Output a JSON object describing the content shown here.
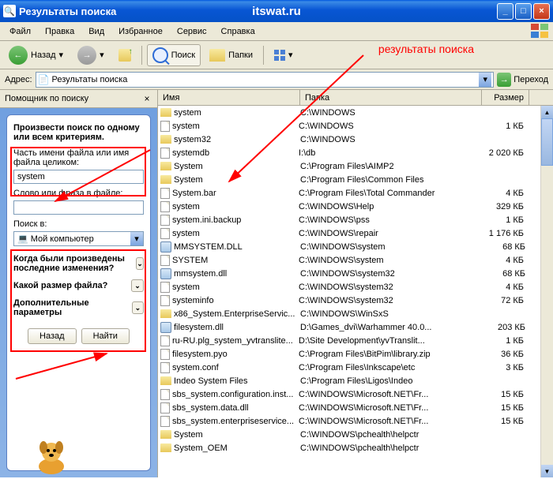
{
  "window": {
    "title": "Результаты поиска",
    "center_text": "itswat.ru"
  },
  "menu": {
    "file": "Файл",
    "edit": "Правка",
    "view": "Вид",
    "favorites": "Избранное",
    "tools": "Сервис",
    "help": "Справка"
  },
  "toolbar": {
    "back": "Назад",
    "search": "Поиск",
    "folders": "Папки",
    "annotation": "результаты поиска"
  },
  "address": {
    "label": "Адрес:",
    "value": "Результаты поиска",
    "go": "Переход"
  },
  "sidebar": {
    "header": "Помощник по поиску",
    "criteria": "Произвести поиск по одному или всем критериям.",
    "filename_label": "Часть имени файла или имя файла целиком:",
    "filename_value": "system",
    "phrase_label": "Слово или фраза в файле:",
    "phrase_value": "",
    "lookin_label": "Поиск в:",
    "lookin_value": "Мой компьютер",
    "expand_modified": "Когда были произведены последние изменения?",
    "expand_size": "Какой размер файла?",
    "expand_more": "Дополнительные параметры",
    "btn_back": "Назад",
    "btn_find": "Найти"
  },
  "columns": {
    "name": "Имя",
    "folder": "Папка",
    "size": "Размер"
  },
  "rows": [
    {
      "icon": "fld",
      "name": "system",
      "path": "C:\\WINDOWS",
      "size": ""
    },
    {
      "icon": "fil",
      "name": "system",
      "path": "C:\\WINDOWS",
      "size": "1 КБ"
    },
    {
      "icon": "fld",
      "name": "system32",
      "path": "C:\\WINDOWS",
      "size": ""
    },
    {
      "icon": "fil",
      "name": "systemdb",
      "path": "I:\\db",
      "size": "2 020 КБ"
    },
    {
      "icon": "fld",
      "name": "System",
      "path": "C:\\Program Files\\AIMP2",
      "size": ""
    },
    {
      "icon": "fld",
      "name": "System",
      "path": "C:\\Program Files\\Common Files",
      "size": ""
    },
    {
      "icon": "fil",
      "name": "System.bar",
      "path": "C:\\Program Files\\Total Commander",
      "size": "4 КБ"
    },
    {
      "icon": "fil",
      "name": "system",
      "path": "C:\\WINDOWS\\Help",
      "size": "329 КБ"
    },
    {
      "icon": "fil",
      "name": "system.ini.backup",
      "path": "C:\\WINDOWS\\pss",
      "size": "1 КБ"
    },
    {
      "icon": "fil",
      "name": "system",
      "path": "C:\\WINDOWS\\repair",
      "size": "1 176 КБ"
    },
    {
      "icon": "dll",
      "name": "MMSYSTEM.DLL",
      "path": "C:\\WINDOWS\\system",
      "size": "68 КБ"
    },
    {
      "icon": "fil",
      "name": "SYSTEM",
      "path": "C:\\WINDOWS\\system",
      "size": "4 КБ"
    },
    {
      "icon": "dll",
      "name": "mmsystem.dll",
      "path": "C:\\WINDOWS\\system32",
      "size": "68 КБ"
    },
    {
      "icon": "fil",
      "name": "system",
      "path": "C:\\WINDOWS\\system32",
      "size": "4 КБ"
    },
    {
      "icon": "fil",
      "name": "systeminfo",
      "path": "C:\\WINDOWS\\system32",
      "size": "72 КБ"
    },
    {
      "icon": "fld",
      "name": "x86_System.EnterpriseServic...",
      "path": "C:\\WINDOWS\\WinSxS",
      "size": ""
    },
    {
      "icon": "dll",
      "name": "filesystem.dll",
      "path": "D:\\Games_dvi\\Warhammer 40.0...",
      "size": "203 КБ"
    },
    {
      "icon": "fil",
      "name": "ru-RU.plg_system_yvtranslite...",
      "path": "D:\\Site Development\\yvTranslit...",
      "size": "1 КБ"
    },
    {
      "icon": "fil",
      "name": "filesystem.pyo",
      "path": "C:\\Program Files\\BitPim\\library.zip",
      "size": "36 КБ"
    },
    {
      "icon": "fil",
      "name": "system.conf",
      "path": "C:\\Program Files\\Inkscape\\etc",
      "size": "3 КБ"
    },
    {
      "icon": "fld",
      "name": "Indeo System Files",
      "path": "C:\\Program Files\\Ligos\\Indeo",
      "size": ""
    },
    {
      "icon": "fil",
      "name": "sbs_system.configuration.inst...",
      "path": "C:\\WINDOWS\\Microsoft.NET\\Fr...",
      "size": "15 КБ"
    },
    {
      "icon": "fil",
      "name": "sbs_system.data.dll",
      "path": "C:\\WINDOWS\\Microsoft.NET\\Fr...",
      "size": "15 КБ"
    },
    {
      "icon": "fil",
      "name": "sbs_system.enterpriseservice...",
      "path": "C:\\WINDOWS\\Microsoft.NET\\Fr...",
      "size": "15 КБ"
    },
    {
      "icon": "fld",
      "name": "System",
      "path": "C:\\WINDOWS\\pchealth\\helpctr",
      "size": ""
    },
    {
      "icon": "fld",
      "name": "System_OEM",
      "path": "C:\\WINDOWS\\pchealth\\helpctr",
      "size": ""
    }
  ]
}
